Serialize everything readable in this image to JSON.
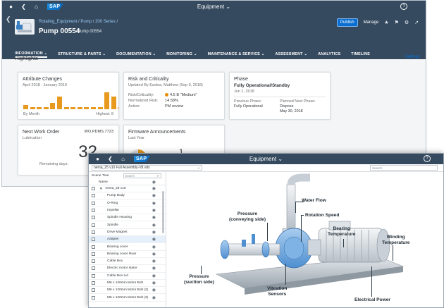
{
  "back": {
    "shell": {
      "title": "Equipment",
      "help": "?"
    },
    "header": {
      "breadcrumbs": [
        "Rotating_Equipment",
        "Pump",
        "200 Series"
      ],
      "title": "Pump 00554",
      "subtitle": "Pump 00554",
      "publish_label": "Publish",
      "manage_label": "Manage"
    },
    "nav": [
      "INFORMATION",
      "STRUCTURE & PARTS",
      "DOCUMENTATION",
      "MONITORING",
      "MAINTENANCE & SERVICE",
      "ASSESSMENT",
      "ANALYTICS",
      "TIMELINE"
    ],
    "highlights": "Highlights",
    "settings": "Settings",
    "attr_card": {
      "title": "Attribute Changes",
      "range": "April 2018 - January 2019",
      "by": "By Month",
      "highest": "Highest: 8",
      "bars": [
        2,
        1,
        1,
        1,
        3,
        6,
        1,
        1,
        1,
        1,
        1,
        1,
        8,
        6,
        1,
        1,
        3
      ]
    },
    "risk_card": {
      "title": "Risk and Criticality",
      "updated": "Updated By Easlea, Matthew (Sep 9, 2018)",
      "risk_label": "Risk/Criticality:",
      "risk_value": "4.5  B  \"Medium\"",
      "norm_label": "Normalized Risk:",
      "norm_value": "14.58%",
      "action_label": "Action:",
      "action_value": "PM review"
    },
    "phase_card": {
      "title": "Phase",
      "status": "Fully Operational/Standby",
      "date": "Jun 1, 2018",
      "prev_label": "Previous Phase:",
      "prev_value": "Fully Operational",
      "next_label": "Planned Next Phase:",
      "next_value": "Dispose",
      "next_date": "May 30, 2018"
    },
    "wo_card": {
      "title": "Next Work Order",
      "wo_id": "WO.PDMS.7723",
      "type": "Lubrication",
      "remaining": "Remaining days:",
      "days": "32"
    },
    "fw_card": {
      "title": "Firmware Announcements",
      "sub": "Last Year",
      "count": "1"
    }
  },
  "front": {
    "shell": {
      "title": "Equipment",
      "help": "?"
    },
    "model": "nema_25 v10 Full Assembly-V8.vds",
    "search_placeholder": "Search",
    "tree": {
      "label": "Scene Tree",
      "search_placeholder": "Search",
      "column": "Name",
      "root": "nema_25 v10",
      "items": [
        "Pump Body",
        "O-Ring",
        "Impellar",
        "Spindle Housing",
        "Spindle",
        "Drive Magnet",
        "Adapter",
        "Bearing cover",
        "Bearing cover Rear",
        "Cable Box",
        "Electric motor stator",
        "Cable Box Lid",
        "M6 x 120mm Motor Bolt",
        "M6 x 120mm Motor Bolt (2)",
        "M6 x 120mm Motor Bolt (3)"
      ],
      "selected_index": 6
    },
    "labels": {
      "water_flow": "Water Flow",
      "pressure_conv": "Pressure\n(conveying side)",
      "rotation": "Rotation Speed",
      "bearing_temp": "Bearing\nTemperature",
      "winding_temp": "Winding\nTemperature",
      "pressure_suct": "Pressure\n(suction side)",
      "vibration": "Vibration\nSensors",
      "power": "Electrical Power"
    }
  },
  "colors": {
    "shell": "#354a5f",
    "accent": "#0a6ed1",
    "bar": "#e89a1e",
    "risk": "#e78c07"
  }
}
